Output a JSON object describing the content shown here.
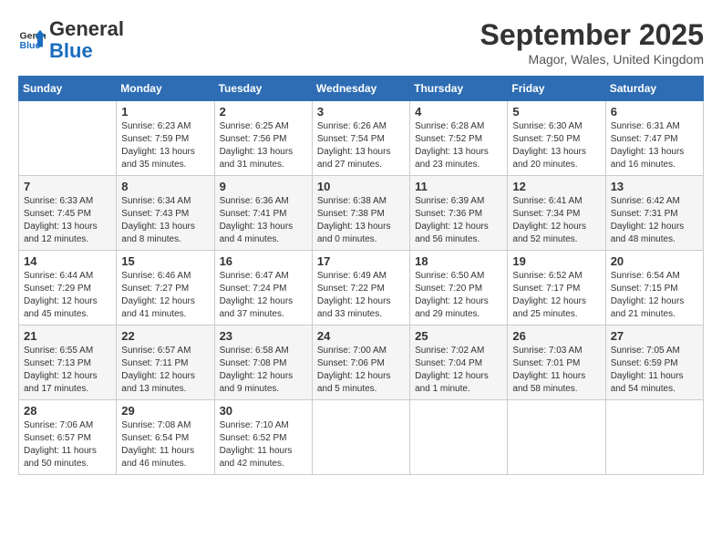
{
  "header": {
    "logo_line1": "General",
    "logo_line2": "Blue",
    "month": "September 2025",
    "location": "Magor, Wales, United Kingdom"
  },
  "weekdays": [
    "Sunday",
    "Monday",
    "Tuesday",
    "Wednesday",
    "Thursday",
    "Friday",
    "Saturday"
  ],
  "weeks": [
    [
      {
        "day": "",
        "info": ""
      },
      {
        "day": "1",
        "info": "Sunrise: 6:23 AM\nSunset: 7:59 PM\nDaylight: 13 hours\nand 35 minutes."
      },
      {
        "day": "2",
        "info": "Sunrise: 6:25 AM\nSunset: 7:56 PM\nDaylight: 13 hours\nand 31 minutes."
      },
      {
        "day": "3",
        "info": "Sunrise: 6:26 AM\nSunset: 7:54 PM\nDaylight: 13 hours\nand 27 minutes."
      },
      {
        "day": "4",
        "info": "Sunrise: 6:28 AM\nSunset: 7:52 PM\nDaylight: 13 hours\nand 23 minutes."
      },
      {
        "day": "5",
        "info": "Sunrise: 6:30 AM\nSunset: 7:50 PM\nDaylight: 13 hours\nand 20 minutes."
      },
      {
        "day": "6",
        "info": "Sunrise: 6:31 AM\nSunset: 7:47 PM\nDaylight: 13 hours\nand 16 minutes."
      }
    ],
    [
      {
        "day": "7",
        "info": "Sunrise: 6:33 AM\nSunset: 7:45 PM\nDaylight: 13 hours\nand 12 minutes."
      },
      {
        "day": "8",
        "info": "Sunrise: 6:34 AM\nSunset: 7:43 PM\nDaylight: 13 hours\nand 8 minutes."
      },
      {
        "day": "9",
        "info": "Sunrise: 6:36 AM\nSunset: 7:41 PM\nDaylight: 13 hours\nand 4 minutes."
      },
      {
        "day": "10",
        "info": "Sunrise: 6:38 AM\nSunset: 7:38 PM\nDaylight: 13 hours\nand 0 minutes."
      },
      {
        "day": "11",
        "info": "Sunrise: 6:39 AM\nSunset: 7:36 PM\nDaylight: 12 hours\nand 56 minutes."
      },
      {
        "day": "12",
        "info": "Sunrise: 6:41 AM\nSunset: 7:34 PM\nDaylight: 12 hours\nand 52 minutes."
      },
      {
        "day": "13",
        "info": "Sunrise: 6:42 AM\nSunset: 7:31 PM\nDaylight: 12 hours\nand 48 minutes."
      }
    ],
    [
      {
        "day": "14",
        "info": "Sunrise: 6:44 AM\nSunset: 7:29 PM\nDaylight: 12 hours\nand 45 minutes."
      },
      {
        "day": "15",
        "info": "Sunrise: 6:46 AM\nSunset: 7:27 PM\nDaylight: 12 hours\nand 41 minutes."
      },
      {
        "day": "16",
        "info": "Sunrise: 6:47 AM\nSunset: 7:24 PM\nDaylight: 12 hours\nand 37 minutes."
      },
      {
        "day": "17",
        "info": "Sunrise: 6:49 AM\nSunset: 7:22 PM\nDaylight: 12 hours\nand 33 minutes."
      },
      {
        "day": "18",
        "info": "Sunrise: 6:50 AM\nSunset: 7:20 PM\nDaylight: 12 hours\nand 29 minutes."
      },
      {
        "day": "19",
        "info": "Sunrise: 6:52 AM\nSunset: 7:17 PM\nDaylight: 12 hours\nand 25 minutes."
      },
      {
        "day": "20",
        "info": "Sunrise: 6:54 AM\nSunset: 7:15 PM\nDaylight: 12 hours\nand 21 minutes."
      }
    ],
    [
      {
        "day": "21",
        "info": "Sunrise: 6:55 AM\nSunset: 7:13 PM\nDaylight: 12 hours\nand 17 minutes."
      },
      {
        "day": "22",
        "info": "Sunrise: 6:57 AM\nSunset: 7:11 PM\nDaylight: 12 hours\nand 13 minutes."
      },
      {
        "day": "23",
        "info": "Sunrise: 6:58 AM\nSunset: 7:08 PM\nDaylight: 12 hours\nand 9 minutes."
      },
      {
        "day": "24",
        "info": "Sunrise: 7:00 AM\nSunset: 7:06 PM\nDaylight: 12 hours\nand 5 minutes."
      },
      {
        "day": "25",
        "info": "Sunrise: 7:02 AM\nSunset: 7:04 PM\nDaylight: 12 hours\nand 1 minute."
      },
      {
        "day": "26",
        "info": "Sunrise: 7:03 AM\nSunset: 7:01 PM\nDaylight: 11 hours\nand 58 minutes."
      },
      {
        "day": "27",
        "info": "Sunrise: 7:05 AM\nSunset: 6:59 PM\nDaylight: 11 hours\nand 54 minutes."
      }
    ],
    [
      {
        "day": "28",
        "info": "Sunrise: 7:06 AM\nSunset: 6:57 PM\nDaylight: 11 hours\nand 50 minutes."
      },
      {
        "day": "29",
        "info": "Sunrise: 7:08 AM\nSunset: 6:54 PM\nDaylight: 11 hours\nand 46 minutes."
      },
      {
        "day": "30",
        "info": "Sunrise: 7:10 AM\nSunset: 6:52 PM\nDaylight: 11 hours\nand 42 minutes."
      },
      {
        "day": "",
        "info": ""
      },
      {
        "day": "",
        "info": ""
      },
      {
        "day": "",
        "info": ""
      },
      {
        "day": "",
        "info": ""
      }
    ]
  ]
}
